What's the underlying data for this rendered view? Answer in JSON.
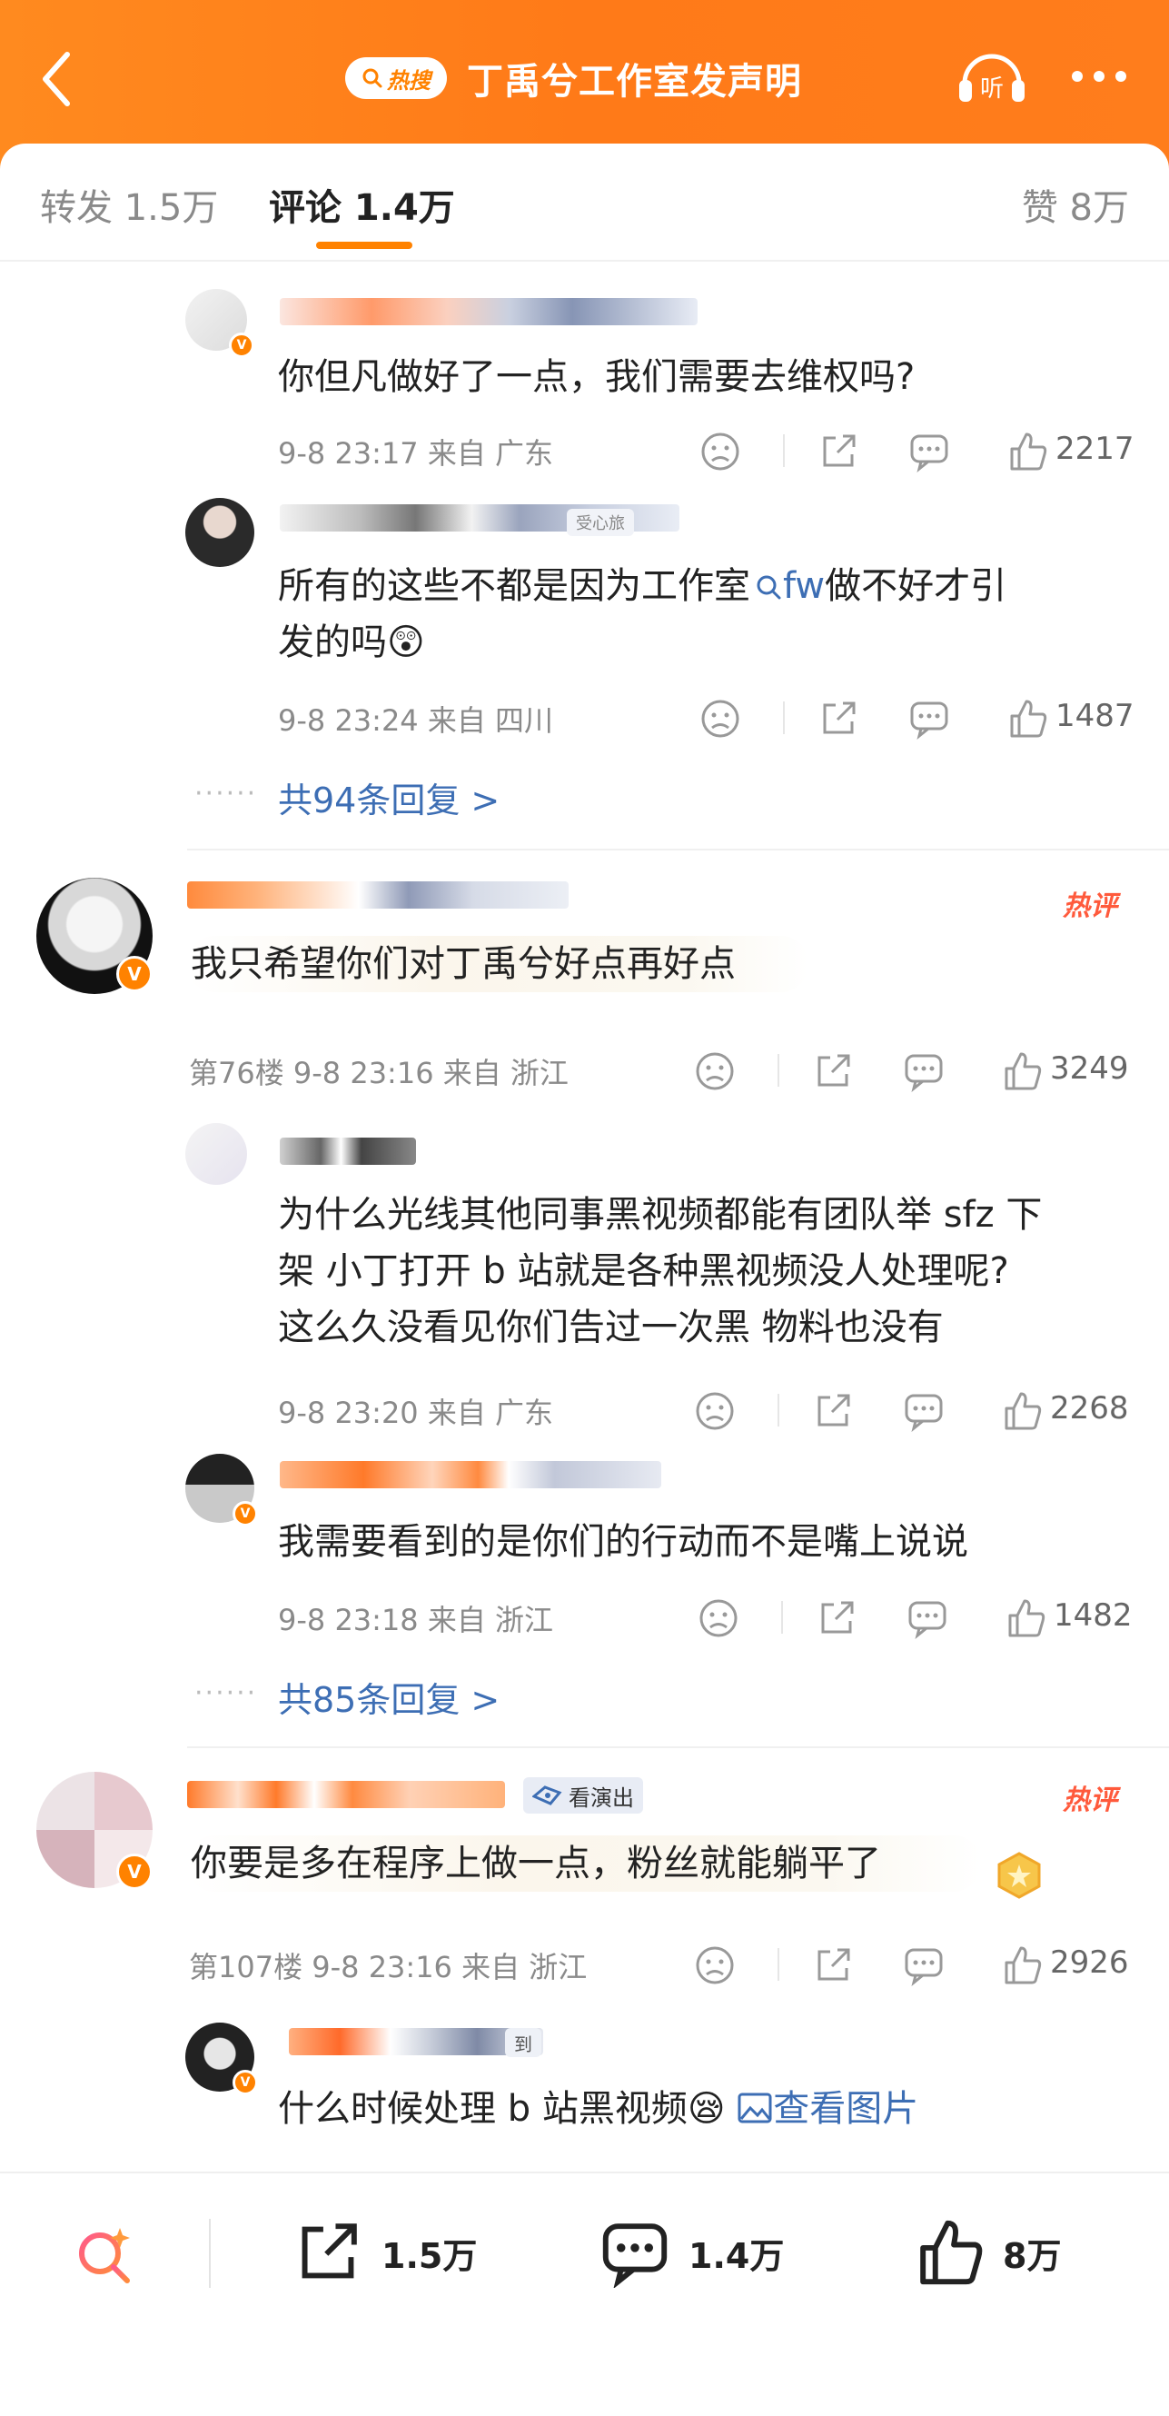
{
  "header": {
    "hot_label": "热搜",
    "title": "丁禹兮工作室发声明",
    "listen_label": "听"
  },
  "tabs": {
    "repost": "转发 1.5万",
    "comments": "评论 1.4万",
    "likes": "赞 8万"
  },
  "threads": [
    {
      "replies": [
        {
          "text": "你但凡做好了一点，我们需要去维权吗?",
          "meta": "9-8 23:17 来自 广东",
          "likes": "2217"
        },
        {
          "text_line1_pre": "所有的这些不都是因为工作室",
          "link_icon": "search-icon",
          "link": "fw",
          "text_line1_post": "做不好才引",
          "text_line2": "发的吗",
          "emoji": "😲",
          "meta": "9-8 23:24 来自 四川",
          "likes": "1487",
          "name_tag": "受心旅"
        }
      ],
      "more_replies": "共94条回复 >"
    },
    {
      "main": {
        "text": "我只希望你们对丁禹兮好点再好点",
        "hot_tag": "热评",
        "meta": "第76楼 9-8 23:16 来自 浙江",
        "likes": "3249"
      },
      "replies": [
        {
          "line1": "为什么光线其他同事黑视频都能有团队举 sfz 下",
          "line2": "架  小丁打开 b 站就是各种黑视频没人处理呢?",
          "line3": "这么久没看见你们告过一次黑  物料也没有",
          "meta": "9-8 23:20 来自 广东",
          "likes": "2268"
        },
        {
          "text": "我需要看到的是你们的行动而不是嘴上说说",
          "meta": "9-8 23:18 来自 浙江",
          "likes": "1482"
        }
      ],
      "more_replies": "共85条回复 >"
    },
    {
      "main": {
        "text": "你要是多在程序上做一点，粉丝就能躺平了",
        "hot_tag": "热评",
        "ad_label": "看演出",
        "meta": "第107楼 9-8 23:16 来自 浙江",
        "likes": "2926"
      },
      "replies": [
        {
          "text": "什么时候处理 b 站黑视频",
          "emoji": "😪",
          "image_link": "查看图片",
          "name_tag": "到"
        }
      ]
    }
  ],
  "bottom_bar": {
    "reposts": "1.5万",
    "comments": "1.4万",
    "likes": "8万"
  },
  "colors": {
    "brand": "#ff8200",
    "link": "#3d6eb4",
    "hot": "#ff5a3c"
  }
}
